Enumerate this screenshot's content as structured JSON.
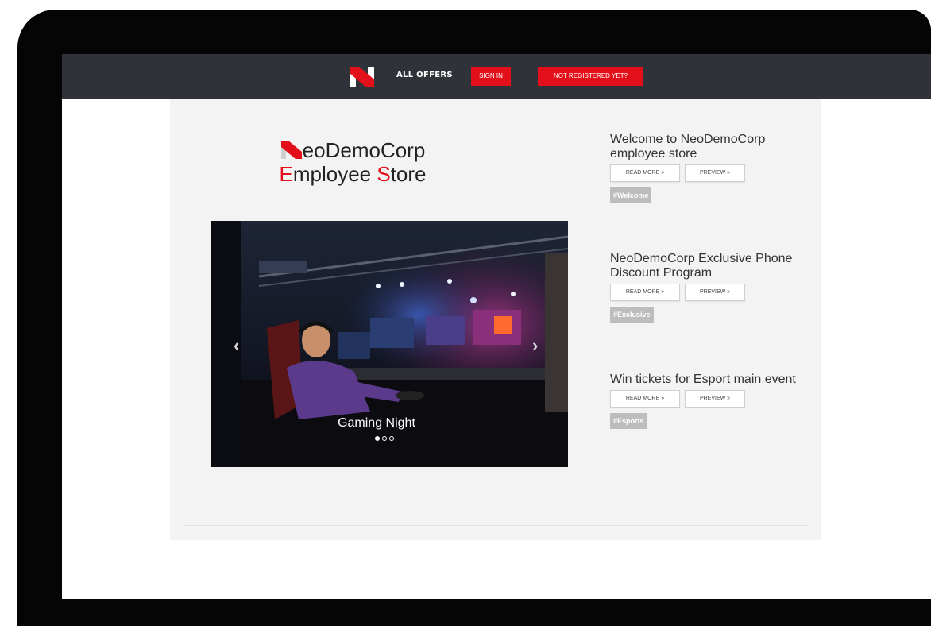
{
  "nav": {
    "all_offers": "ALL OFFERS",
    "sign_in": "SIGN IN",
    "register": "NOT REGISTERED YET?"
  },
  "brand": {
    "line1_rest": "eoDemoCorp",
    "line2_e": "E",
    "line2_mid": "mployee ",
    "line2_s": "S",
    "line2_end": "tore"
  },
  "carousel": {
    "caption": "Gaming Night",
    "slides": 3,
    "active_slide": 1,
    "prev_icon": "‹",
    "next_icon": "›"
  },
  "posts": [
    {
      "title": "Welcome to NeoDemoCorp employee store",
      "read_more": "READ MORE »",
      "preview": "PREVIEW »",
      "tag": "#Welcome"
    },
    {
      "title": "NeoDemoCorp Exclusive Phone Discount Program",
      "read_more": "READ MORE »",
      "preview": "PREVIEW »",
      "tag": "#Exclusive"
    },
    {
      "title": "Win tickets for Esport main event",
      "read_more": "READ MORE »",
      "preview": "PREVIEW »",
      "tag": "#Esports"
    }
  ],
  "colors": {
    "accent": "#e3101b",
    "navbar": "#2f3339",
    "content_bg": "#f3f3f3"
  }
}
